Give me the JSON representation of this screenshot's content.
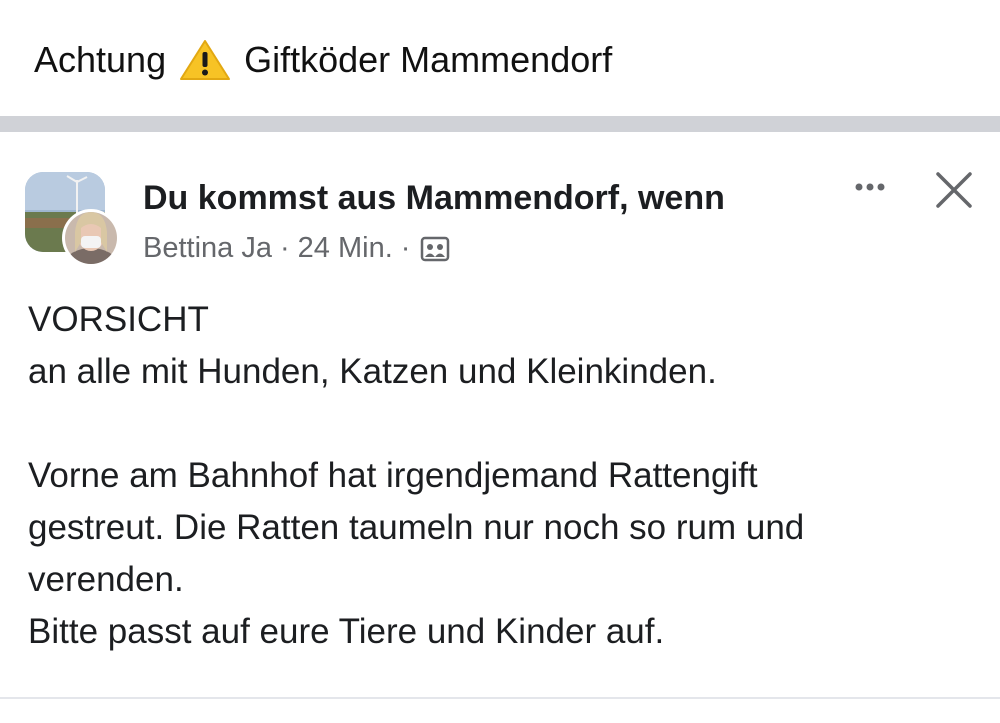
{
  "headline": {
    "text_before": "Achtung",
    "icon": "warning-sign-icon",
    "text_after": "Giftköder Mammendorf"
  },
  "post": {
    "group_name": "Du kommst aus Mammendorf, wenn",
    "author": "Bettina Ja",
    "separator": "·",
    "time": "24 Min.",
    "privacy_icon": "group-members-icon",
    "more_icon": "more-options-icon",
    "close_icon": "close-icon",
    "body": {
      "line1": "VORSICHT",
      "line2": "an alle mit Hunden, Katzen und Kleinkinden.",
      "line3": "Vorne am Bahnhof hat irgendjemand Rattengift",
      "line4": "gestreut. Die Ratten taumeln nur noch so rum und",
      "line5": "verenden.",
      "line6": "Bitte passt auf eure Tiere und Kinder auf."
    }
  },
  "colors": {
    "text_primary": "#1c1e21",
    "text_secondary": "#65676b",
    "separator_bar": "#d0d2d7",
    "warning_yellow": "#f7c325"
  }
}
